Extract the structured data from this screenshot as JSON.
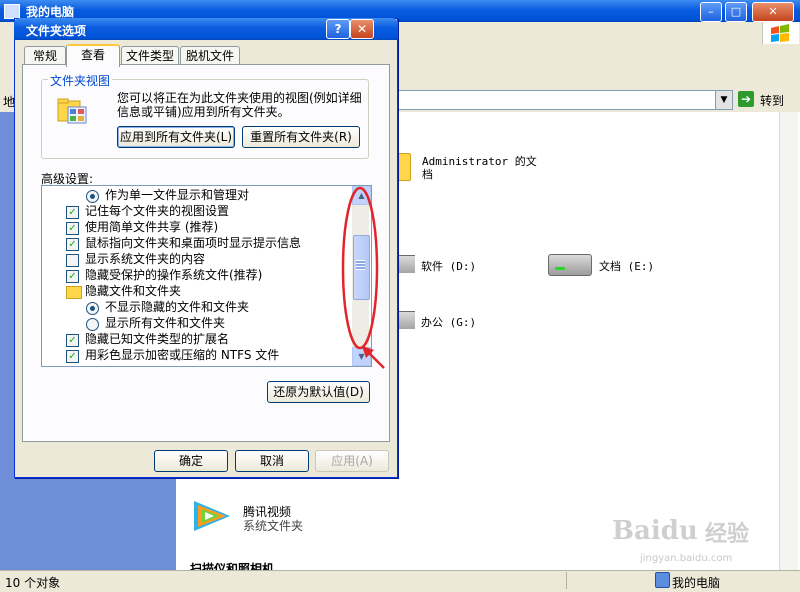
{
  "explorer": {
    "title": "我的电脑",
    "address_go": "转到",
    "address_prefix": "地",
    "items": {
      "admin_docs": "Administrator 的文档",
      "drive_software": "软件 (D:)",
      "drive_docs": "文档 (E:)",
      "drive_office": "办公 (G:)",
      "tencent_video_title": "腾讯视频",
      "tencent_video_sub": "系统文件夹",
      "scanners_heading": "扫描仪和照相机"
    },
    "status_left": "10 个对象",
    "status_right": "我的电脑"
  },
  "dialog": {
    "title": "文件夹选项",
    "help_glyph": "?",
    "close_glyph": "✕",
    "tabs": [
      "常规",
      "查看",
      "文件类型",
      "脱机文件"
    ],
    "active_tab": "查看",
    "folder_view_group": "文件夹视图",
    "folder_view_desc": "您可以将正在为此文件夹使用的视图(例如详细信息或平铺)应用到所有文件夹。",
    "apply_all_button": "应用到所有文件夹(L)",
    "reset_all_button": "重置所有文件夹(R)",
    "advanced_label": "高级设置:",
    "advanced_items": [
      {
        "type": "radio",
        "checked": true,
        "indent": 1,
        "label": "作为单一文件显示和管理对"
      },
      {
        "type": "checkbox",
        "checked": true,
        "indent": 0,
        "label": "记住每个文件夹的视图设置"
      },
      {
        "type": "checkbox",
        "checked": true,
        "indent": 0,
        "label": "使用简单文件共享 (推荐)"
      },
      {
        "type": "checkbox",
        "checked": true,
        "indent": 0,
        "label": "鼠标指向文件夹和桌面项时显示提示信息"
      },
      {
        "type": "checkbox",
        "checked": false,
        "indent": 0,
        "label": "显示系统文件夹的内容"
      },
      {
        "type": "checkbox",
        "checked": true,
        "indent": 0,
        "label": "隐藏受保护的操作系统文件(推荐)"
      },
      {
        "type": "folder",
        "checked": false,
        "indent": 0,
        "label": "隐藏文件和文件夹"
      },
      {
        "type": "radio",
        "checked": true,
        "indent": 1,
        "label": "不显示隐藏的文件和文件夹"
      },
      {
        "type": "radio",
        "checked": false,
        "indent": 1,
        "label": "显示所有文件和文件夹"
      },
      {
        "type": "checkbox",
        "checked": true,
        "indent": 0,
        "label": "隐藏已知文件类型的扩展名"
      },
      {
        "type": "checkbox",
        "checked": true,
        "indent": 0,
        "label": "用彩色显示加密或压缩的 NTFS 文件"
      }
    ],
    "restore_defaults_button": "还原为默认值(D)",
    "ok_button": "确定",
    "cancel_button": "取消",
    "apply_button": "应用(A)"
  },
  "watermark": {
    "brand": "Baidu",
    "brand_suffix": "经验",
    "url": "jingyan.baidu.com"
  },
  "colors": {
    "titlebar": "#0a5be0",
    "annotation": "#e0262a",
    "dialog_bg": "#ece9d8"
  }
}
